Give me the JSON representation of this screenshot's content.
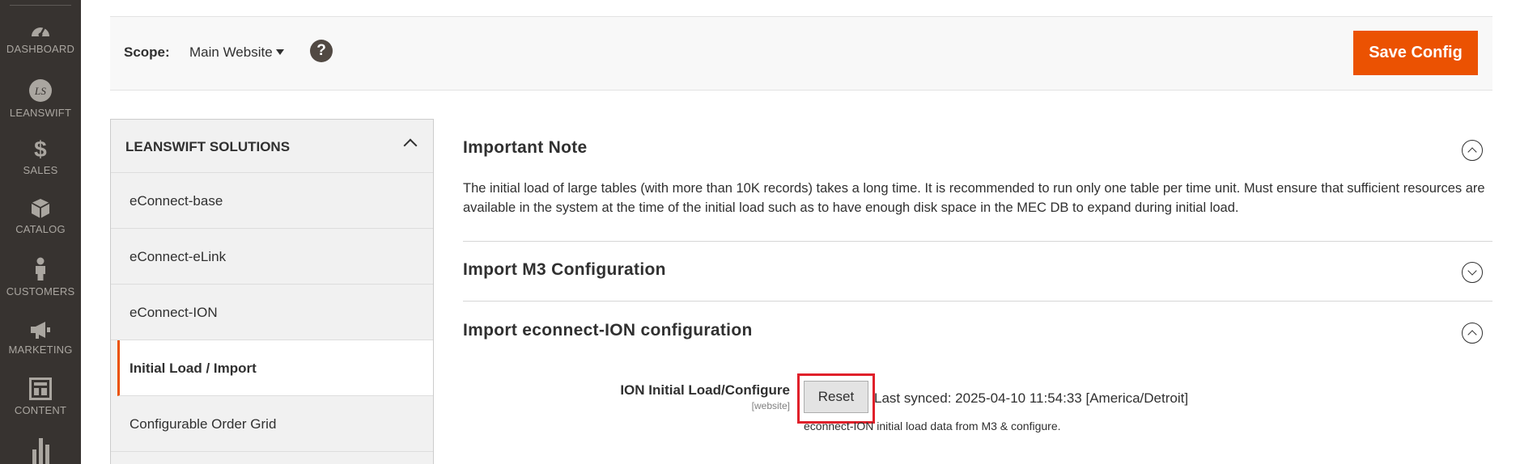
{
  "sidebar": {
    "items": [
      {
        "label": "DASHBOARD",
        "icon": "dashboard-icon"
      },
      {
        "label": "LEANSWIFT",
        "icon": "leanswift-logo",
        "logo_text": "LS"
      },
      {
        "label": "SALES",
        "icon": "dollar-icon"
      },
      {
        "label": "CATALOG",
        "icon": "cube-icon"
      },
      {
        "label": "CUSTOMERS",
        "icon": "person-icon"
      },
      {
        "label": "MARKETING",
        "icon": "megaphone-icon"
      },
      {
        "label": "CONTENT",
        "icon": "layout-icon"
      }
    ]
  },
  "header": {
    "scope_label": "Scope:",
    "scope_value": "Main Website",
    "help_symbol": "?",
    "save_label": "Save Config"
  },
  "config_nav": {
    "title": "LEANSWIFT SOLUTIONS",
    "items": [
      {
        "label": "eConnect-base",
        "active": false
      },
      {
        "label": "eConnect-eLink",
        "active": false
      },
      {
        "label": "eConnect-ION",
        "active": false
      },
      {
        "label": "Initial Load / Import",
        "active": true
      },
      {
        "label": "Configurable Order Grid",
        "active": false
      }
    ]
  },
  "main": {
    "important_note": {
      "title": "Important Note",
      "text": "The initial load of large tables (with more than 10K records) takes a long time. It is recommended to run only one table per time unit. Must ensure that sufficient resources are available in the system at the time of the initial load such as to have enough disk space in the MEC DB to expand during initial load."
    },
    "import_m3": {
      "title": "Import M3 Configuration"
    },
    "import_ion": {
      "title": "Import econnect-ION configuration",
      "field_label": "ION Initial Load/Configure",
      "field_scope": "[website]",
      "reset_label": "Reset",
      "last_synced": "Last synced: 2025-04-10 11:54:33 [America/Detroit]",
      "field_note": "econnect-ION initial load data from M3 & configure."
    }
  },
  "colors": {
    "accent": "#eb5202",
    "sidebar_bg": "#373330",
    "highlight": "#e0202a"
  }
}
